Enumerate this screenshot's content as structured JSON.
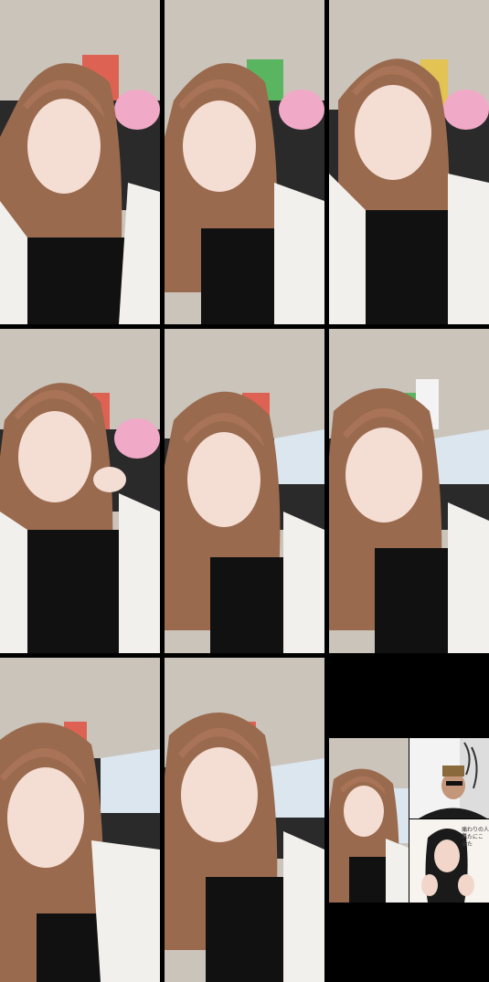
{
  "grid": {
    "rows": 3,
    "columns": 3,
    "frames": [
      {
        "id": "frame-1"
      },
      {
        "id": "frame-2"
      },
      {
        "id": "frame-3"
      },
      {
        "id": "frame-4"
      },
      {
        "id": "frame-5"
      },
      {
        "id": "frame-6"
      },
      {
        "id": "frame-7"
      },
      {
        "id": "frame-8"
      }
    ]
  },
  "collab_frame": {
    "panel_text_line1": "痛わりの人気",
    "panel_text_line2": "来たにこ😊",
    "panel_text_line3": "また"
  },
  "colors": {
    "background": "#000000",
    "wall": "#cbc4bb",
    "hair": "#9a6a4e",
    "top": "#111111",
    "cardigan": "#f1f0ec",
    "skin": "#f4ddd3"
  }
}
